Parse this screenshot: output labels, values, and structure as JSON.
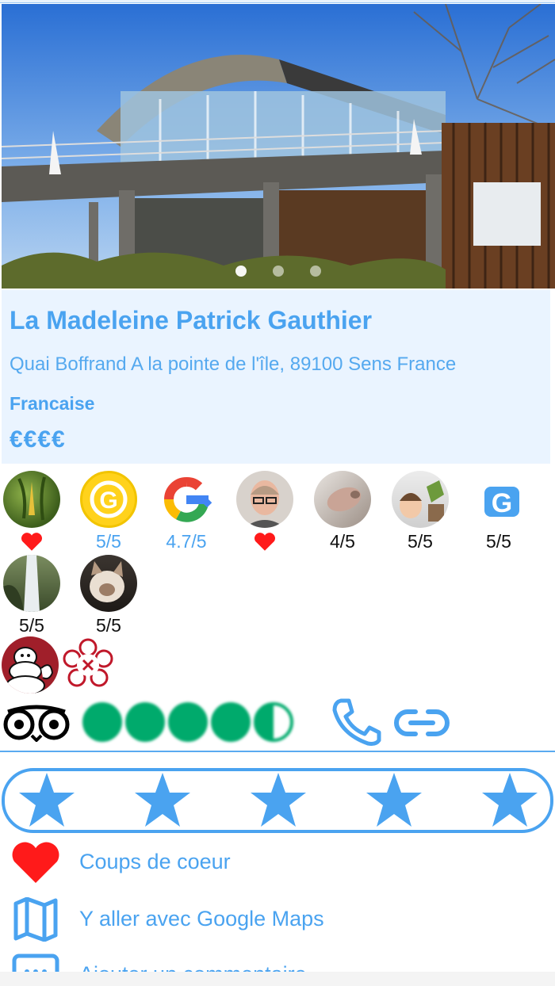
{
  "restaurant": {
    "name": "La Madeleine Patrick Gauthier",
    "address": "Quai Boffrand A la pointe de l'île, 89100 Sens France",
    "cuisine": "Francaise",
    "price": "€€€€"
  },
  "carousel": {
    "image": "restaurant-building-photo",
    "page_count": 3,
    "active_index": 0
  },
  "reviewers": [
    {
      "avatar": "banana-plant-avatar",
      "value": "",
      "heart": true
    },
    {
      "avatar": "gault-millau-logo",
      "value": "5/5",
      "heart": false,
      "blue": true
    },
    {
      "avatar": "google-logo",
      "value": "4.7/5",
      "heart": false,
      "blue": true
    },
    {
      "avatar": "man-portrait-avatar",
      "value": "",
      "heart": true
    },
    {
      "avatar": "hand-photo-avatar",
      "value": "4/5",
      "heart": false
    },
    {
      "avatar": "child-photo-avatar",
      "value": "5/5",
      "heart": false
    },
    {
      "avatar": "g-letter-icon",
      "value": "5/5",
      "heart": false
    },
    {
      "avatar": "waterfall-avatar",
      "value": "5/5",
      "heart": false
    },
    {
      "avatar": "cat-avatar",
      "value": "5/5",
      "heart": false
    }
  ],
  "awards": [
    "michelin-man-icon",
    "michelin-star-icon"
  ],
  "tripadvisor": {
    "bubbles_full": 4,
    "bubbles_half": 1,
    "rating": 4.5
  },
  "colors": {
    "accent": "#4aa3f0",
    "heart": "#ff1a1a",
    "tripadvisor": "#00aa6c"
  },
  "user_rating": {
    "stars": 5
  },
  "actions": [
    {
      "icon": "heart-icon",
      "label": "Coups de coeur"
    },
    {
      "icon": "map-icon",
      "label": "Y aller avec Google Maps"
    },
    {
      "icon": "comment-icon",
      "label": "Ajouter un commentaire"
    }
  ]
}
